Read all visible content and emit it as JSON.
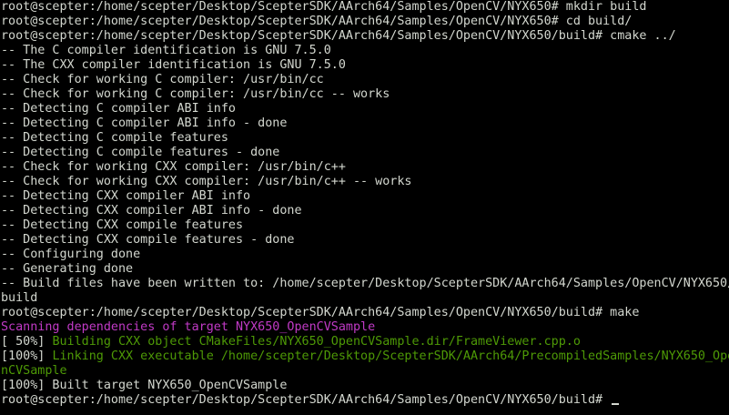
{
  "terminal": {
    "colors": {
      "background": "#000000",
      "foreground": "#d3d7cf",
      "magenta": "#c13ac6",
      "green": "#4e9a06"
    },
    "lines": [
      "root@scepter:/home/scepter/Desktop/ScepterSDK/AArch64/Samples/OpenCV/NYX650# mkdir build",
      "root@scepter:/home/scepter/Desktop/ScepterSDK/AArch64/Samples/OpenCV/NYX650# cd build/",
      "root@scepter:/home/scepter/Desktop/ScepterSDK/AArch64/Samples/OpenCV/NYX650/build# cmake ../",
      "-- The C compiler identification is GNU 7.5.0",
      "-- The CXX compiler identification is GNU 7.5.0",
      "-- Check for working C compiler: /usr/bin/cc",
      "-- Check for working C compiler: /usr/bin/cc -- works",
      "-- Detecting C compiler ABI info",
      "-- Detecting C compiler ABI info - done",
      "-- Detecting C compile features",
      "-- Detecting C compile features - done",
      "-- Check for working CXX compiler: /usr/bin/c++",
      "-- Check for working CXX compiler: /usr/bin/c++ -- works",
      "-- Detecting CXX compiler ABI info",
      "-- Detecting CXX compiler ABI info - done",
      "-- Detecting CXX compile features",
      "-- Detecting CXX compile features - done",
      "-- Configuring done",
      "-- Generating done",
      "-- Build files have been written to: /home/scepter/Desktop/ScepterSDK/AArch64/Samples/OpenCV/NYX650/",
      "build",
      "root@scepter:/home/scepter/Desktop/ScepterSDK/AArch64/Samples/OpenCV/NYX650/build# make",
      "Scanning dependencies of target NYX650_OpenCVSample",
      "[ 50%] ",
      "[100%] ",
      "nCVSample",
      "[100%] Built target NYX650_OpenCVSample",
      "root@scepter:/home/scepter/Desktop/ScepterSDK/AArch64/Samples/OpenCV/NYX650/build# "
    ],
    "colored_segments": {
      "building": "Building CXX object CMakeFiles/NYX650_OpenCVSample.dir/FrameViewer.cpp.o",
      "linking": "Linking CXX executable /home/scepter/Desktop/ScepterSDK/AArch64/PrecompiledSamples/NYX650_Ope"
    }
  }
}
